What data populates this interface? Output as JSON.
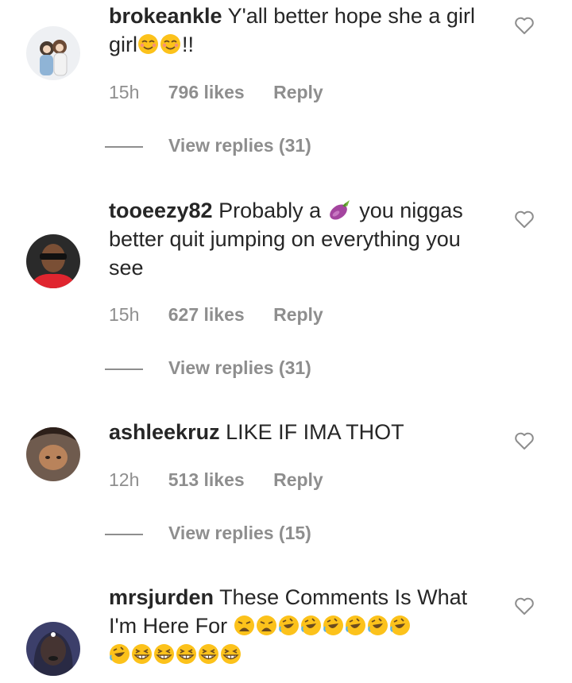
{
  "comments": [
    {
      "username": "brokeankle",
      "text_lines": [
        "Y'all better hope she a girl",
        "girl"
      ],
      "text_suffix": "!!",
      "time": "15h",
      "likes": "796 likes",
      "reply": "Reply",
      "view_replies": "View replies (31)",
      "avatar_icon": "cartoon-couple-avatar"
    },
    {
      "username": "tooeezy82",
      "text_before_emoji": "Probably a",
      "text_after_emoji": "you niggas",
      "text_line2": "better quit jumping on everything you",
      "text_line3": "see",
      "emoji_name": "eggplant-emoji",
      "time": "15h",
      "likes": "627 likes",
      "reply": "Reply",
      "view_replies": "View replies (31)",
      "avatar_icon": "man-sunglasses-avatar"
    },
    {
      "username": "ashleekruz",
      "text": "LIKE IF IMA THOT",
      "time": "12h",
      "likes": "513 likes",
      "reply": "Reply",
      "view_replies": "View replies (15)",
      "avatar_icon": "woman-upside-down-avatar"
    },
    {
      "username": "mrsjurden",
      "text_line1": "These Comments Is What",
      "text_line2": "I'm Here For",
      "avatar_icon": "woman-dark-lipstick-avatar"
    }
  ],
  "colors": {
    "text": "#262626",
    "muted": "#8e8e8e",
    "emoji_yellow": "#fcc21b"
  }
}
